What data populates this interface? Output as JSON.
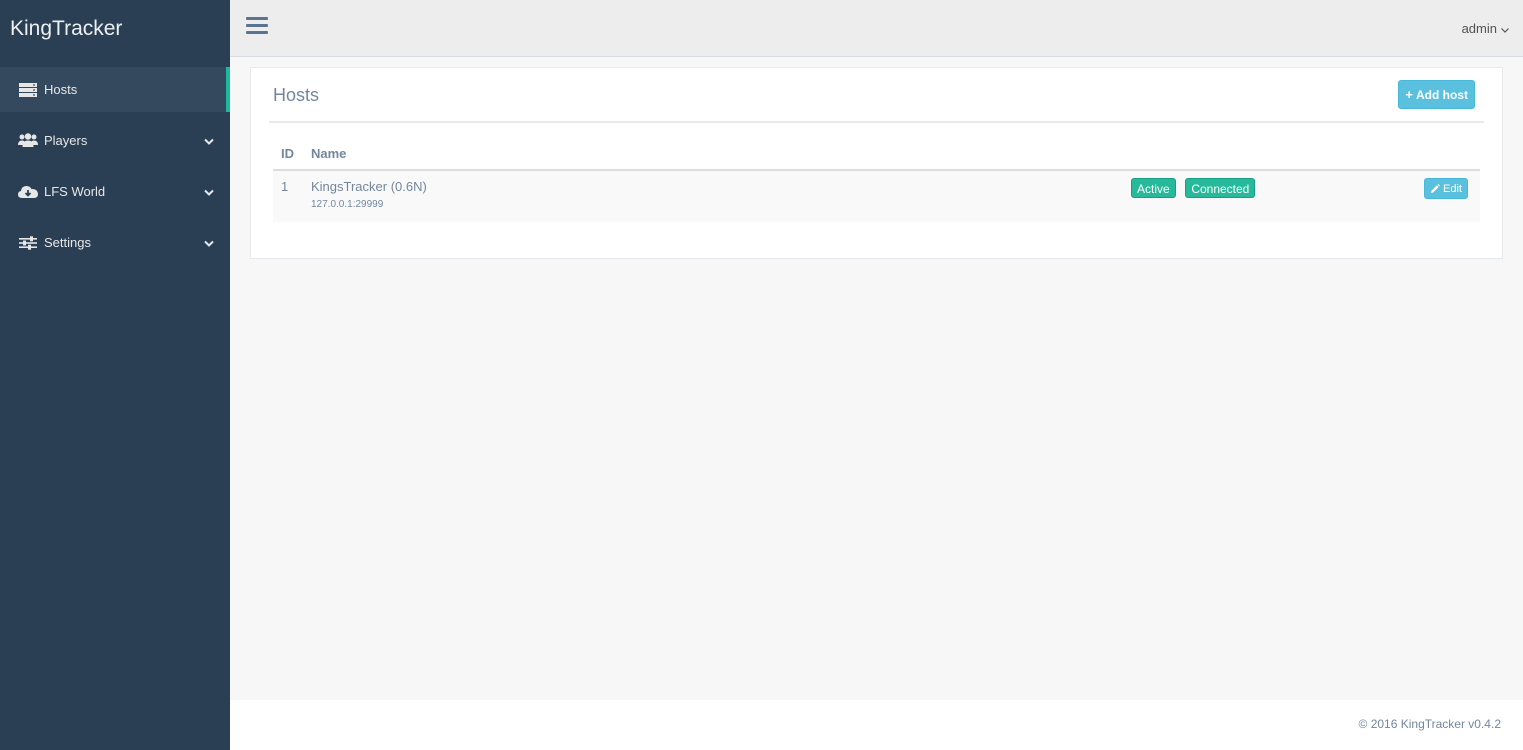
{
  "app": {
    "brand": "KingTracker"
  },
  "sidebar": {
    "items": [
      {
        "label": "Hosts",
        "icon": "server-icon",
        "active": true
      },
      {
        "label": "Players",
        "icon": "users-icon",
        "expandable": true
      },
      {
        "label": "LFS World",
        "icon": "cloud-download-icon",
        "expandable": true
      },
      {
        "label": "Settings",
        "icon": "sliders-icon",
        "expandable": true
      }
    ]
  },
  "topbar": {
    "menu_icon": "hamburger-icon",
    "user": "admin",
    "user_caret": "chevron-down-icon"
  },
  "panel": {
    "title": "Hosts",
    "add_button": "Add host",
    "add_icon": "plus-icon",
    "table": {
      "headers": {
        "id": "ID",
        "name": "Name"
      },
      "rows": [
        {
          "id": "1",
          "name": "KingsTracker (0.6N)",
          "address": "127.0.0.1:29999",
          "status_badges": [
            "Active",
            "Connected"
          ],
          "action": "Edit",
          "action_icon": "pencil-icon"
        }
      ]
    }
  },
  "footer": {
    "text": "© 2016 KingTracker v0.4.2"
  },
  "colors": {
    "sidebar_bg": "#2A3F54",
    "active_accent": "#1ABB9C",
    "badge_green": "#26B99A",
    "button_info": "#5BC0DE"
  }
}
